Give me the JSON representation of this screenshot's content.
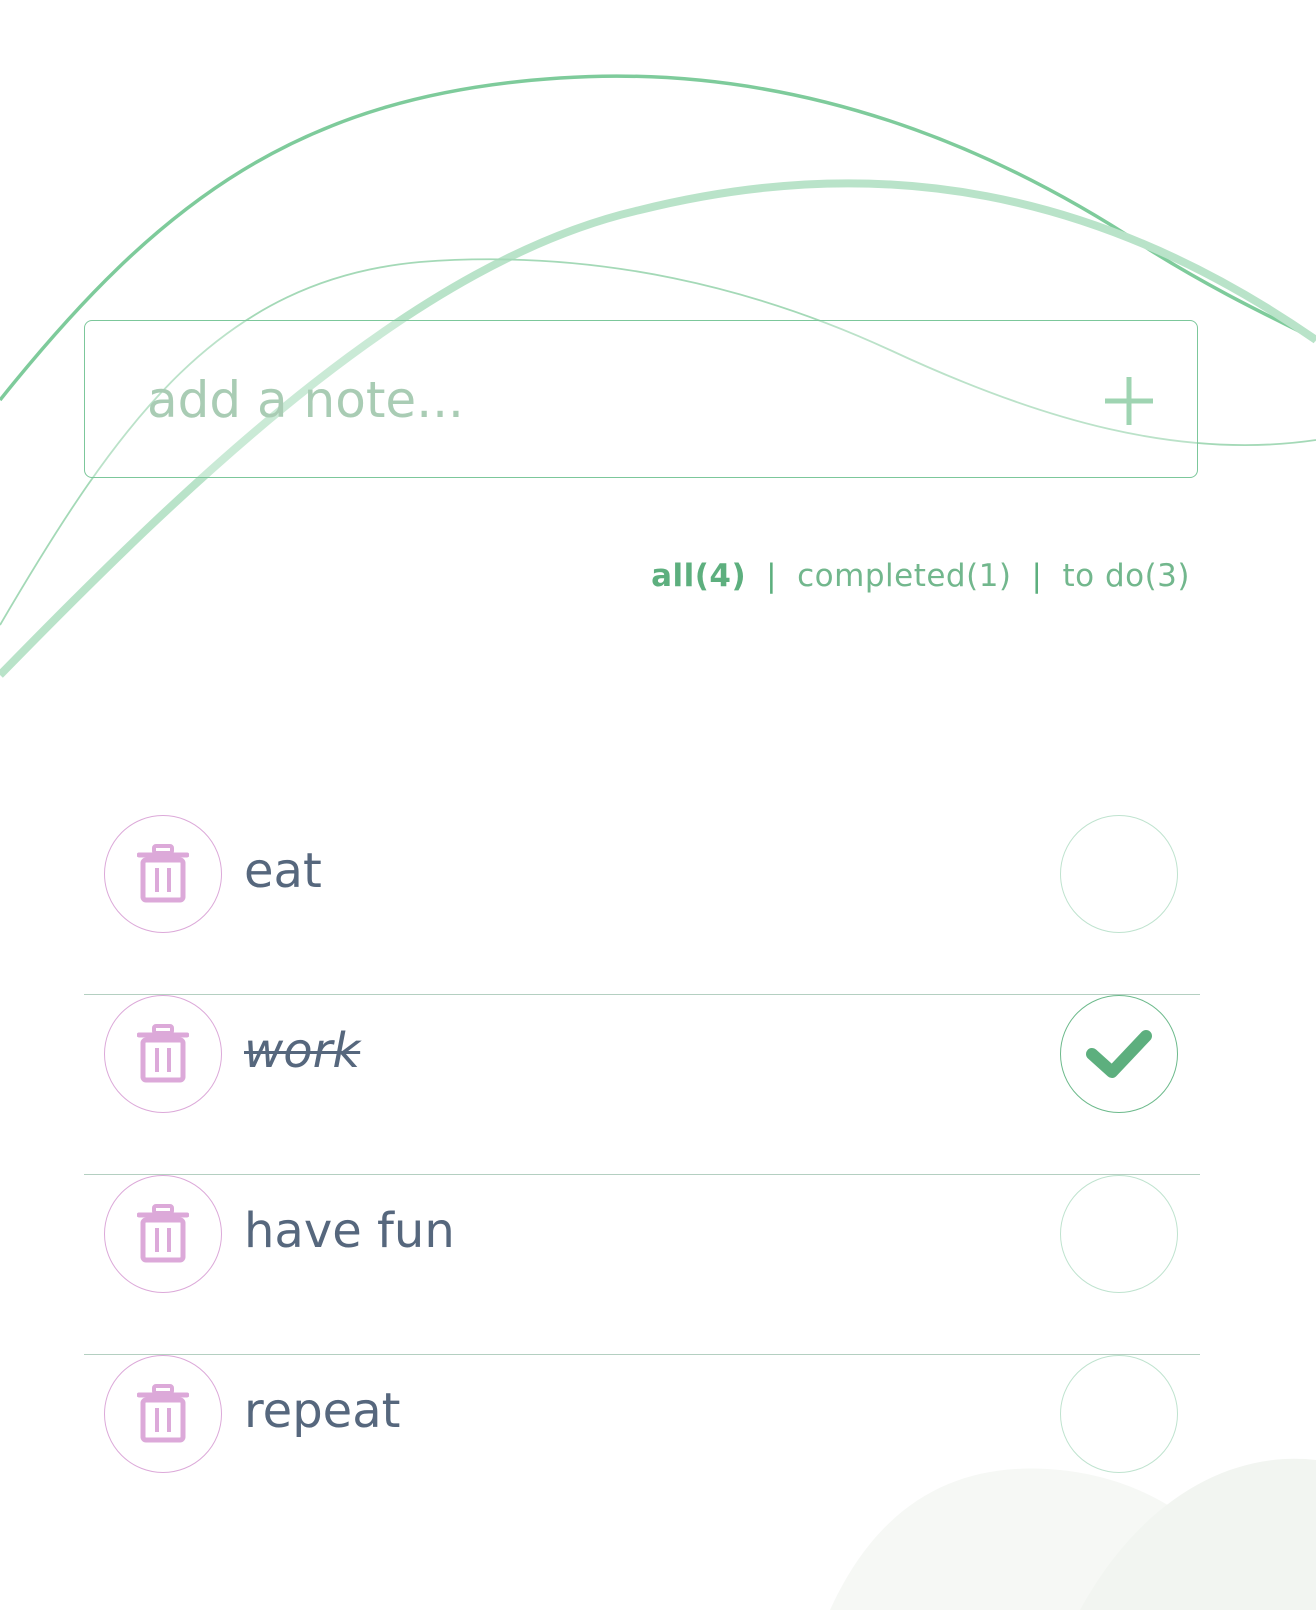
{
  "input": {
    "placeholder": "add a note...",
    "value": ""
  },
  "icons": {
    "add": "plus-icon",
    "delete": "trash-icon",
    "complete": "check-icon"
  },
  "colors": {
    "accent": "#5daf7e",
    "input_border": "#7cc79b",
    "delete_accent": "#dca9d9",
    "todo_text": "#56677d",
    "divider": "#b4cfc1"
  },
  "filters": {
    "all": "all(4)",
    "completed": "completed(1)",
    "todo": "to do(3)",
    "separator": "|",
    "active": "all"
  },
  "todos": [
    {
      "text": "eat",
      "completed": false
    },
    {
      "text": "work",
      "completed": true
    },
    {
      "text": "have fun",
      "completed": false
    },
    {
      "text": "repeat",
      "completed": false
    }
  ]
}
